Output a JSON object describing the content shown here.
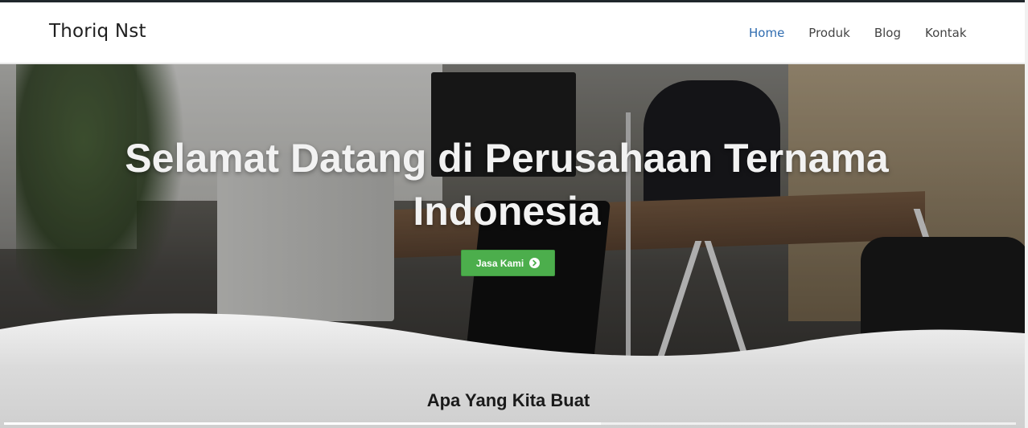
{
  "header": {
    "brand": "Thoriq Nst",
    "nav": [
      {
        "label": "Home",
        "active": true
      },
      {
        "label": "Produk",
        "active": false
      },
      {
        "label": "Blog",
        "active": false
      },
      {
        "label": "Kontak",
        "active": false
      }
    ]
  },
  "hero": {
    "title": "Selamat Datang di Perusahaan Ternama Indonesia",
    "cta_label": "Jasa Kami",
    "cta_icon": "circle-chevron-right-icon"
  },
  "section": {
    "title": "Apa Yang Kita Buat"
  },
  "colors": {
    "accent": "#2f6cb0",
    "button": "#4cae4c"
  },
  "progress": {
    "fraction": 0.59
  }
}
